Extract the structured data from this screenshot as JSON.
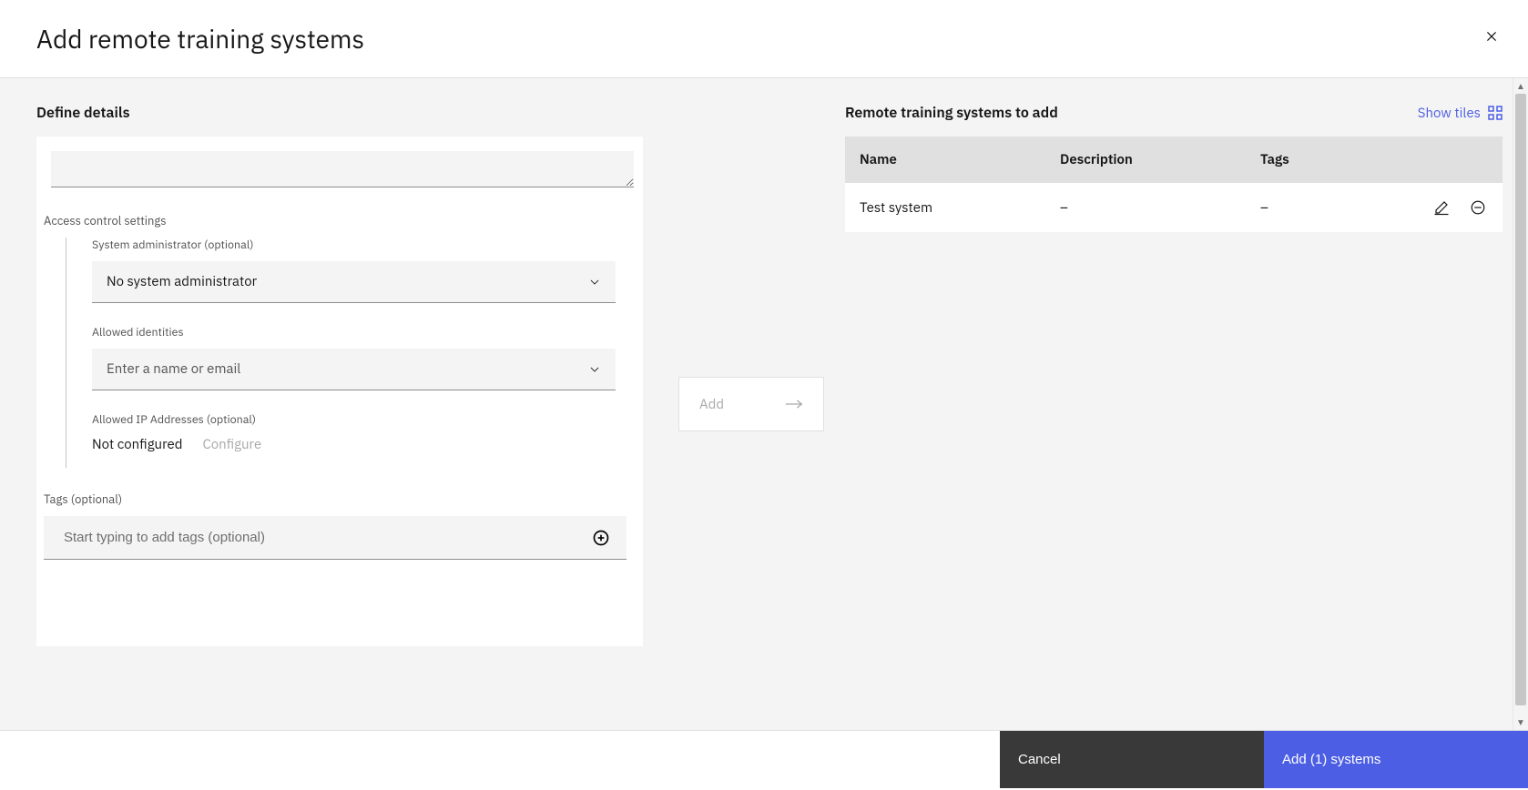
{
  "header": {
    "title": "Add remote training systems"
  },
  "left": {
    "heading": "Define details",
    "access_control_label": "Access control settings",
    "sys_admin_label": "System administrator (optional)",
    "sys_admin_value": "No system administrator",
    "identities_label": "Allowed identities",
    "identities_placeholder": "Enter a name or email",
    "ip_label": "Allowed IP Addresses (optional)",
    "ip_status": "Not configured",
    "ip_configure": "Configure",
    "tags_label": "Tags (optional)",
    "tags_placeholder": "Start typing to add tags (optional)"
  },
  "center": {
    "add_label": "Add"
  },
  "right": {
    "heading": "Remote training systems to add",
    "show_tiles": "Show tiles",
    "columns": {
      "name": "Name",
      "description": "Description",
      "tags": "Tags"
    },
    "rows": [
      {
        "name": "Test system",
        "description": "–",
        "tags": "–"
      }
    ]
  },
  "footer": {
    "cancel": "Cancel",
    "primary": "Add (1) systems"
  }
}
